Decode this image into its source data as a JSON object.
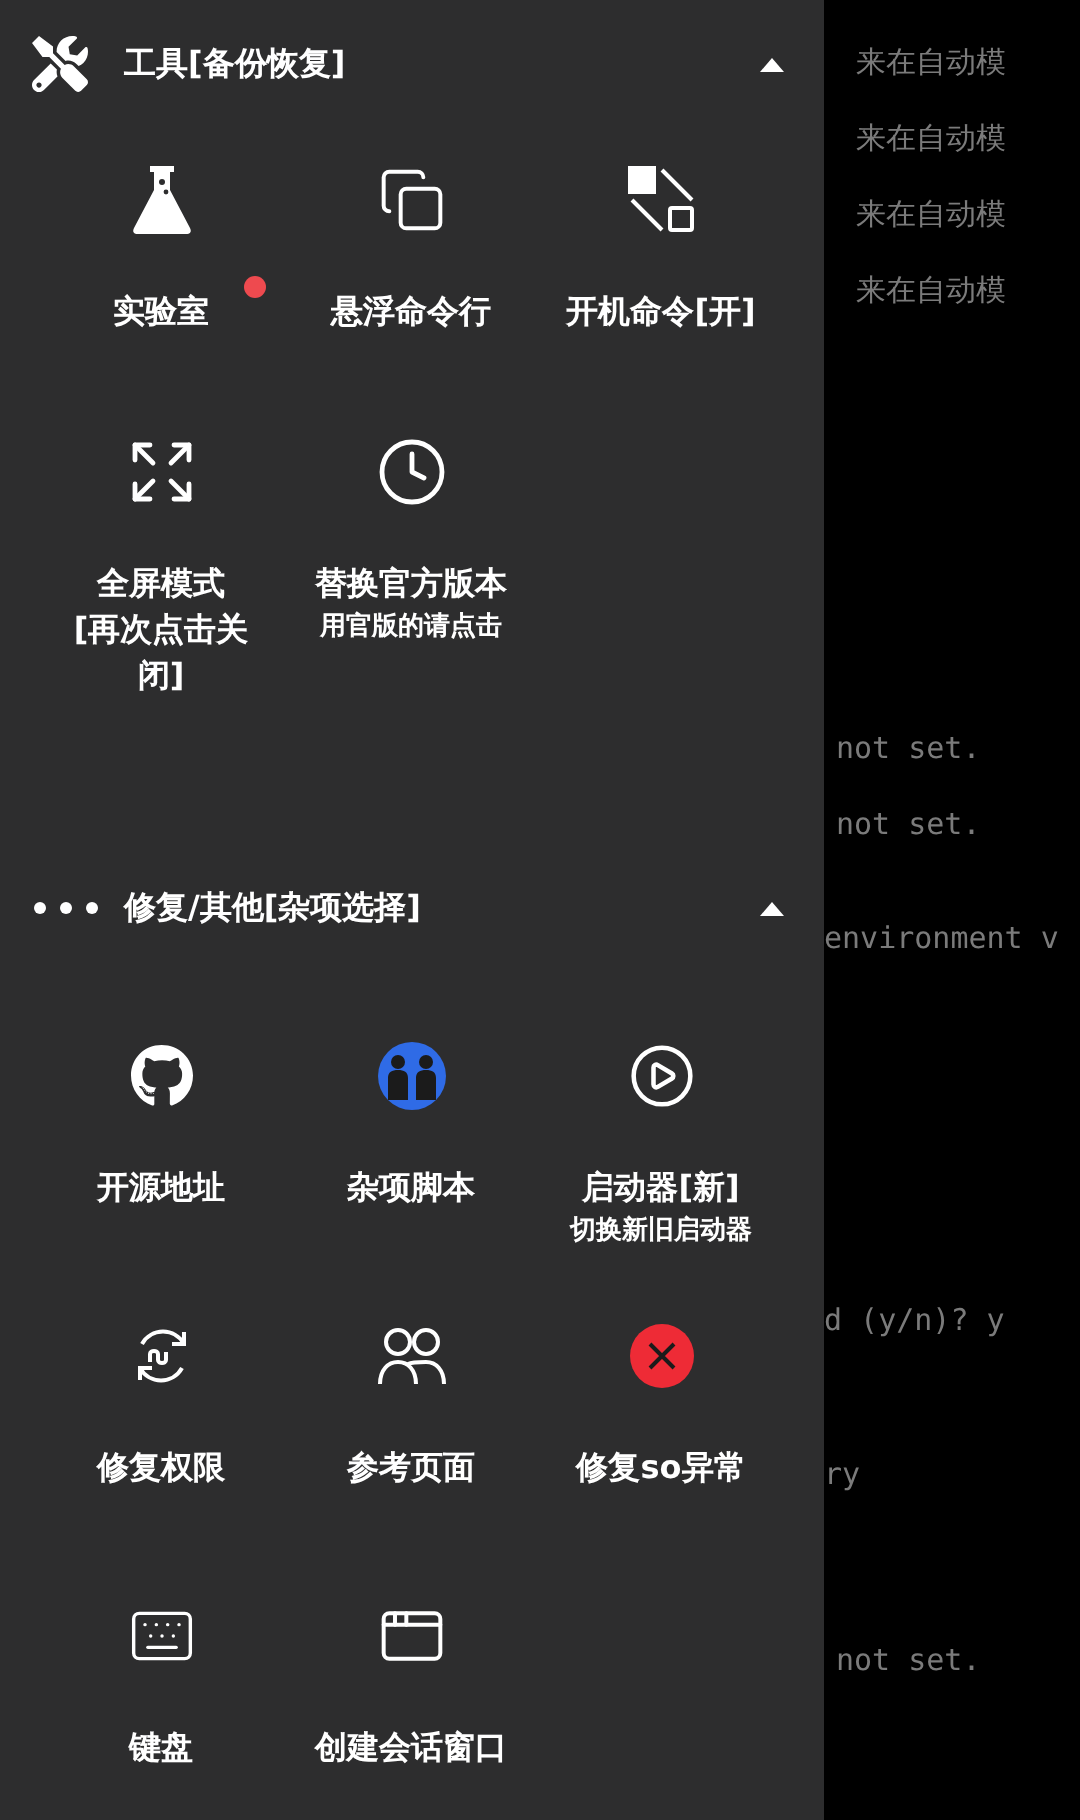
{
  "drawer": {
    "sections": [
      {
        "title": "工具[备份恢复]",
        "expanded": true,
        "items": [
          {
            "label": "实验室",
            "dot": true
          },
          {
            "label": "悬浮命令行",
            "dot": false
          },
          {
            "label": "开机命令[开]",
            "dot": false
          },
          {
            "label": "全屏模式\n[再次点击关闭]",
            "dot": false
          },
          {
            "label": "替换官方版本",
            "sublabel": "用官版的请点击",
            "dot": false
          }
        ]
      },
      {
        "title": "修复/其他[杂项选择]",
        "expanded": true,
        "items": [
          {
            "label": "开源地址",
            "dot": false
          },
          {
            "label": "杂项脚本",
            "dot": false
          },
          {
            "label": "启动器[新]",
            "sublabel": "切换新旧启动器",
            "dot": false
          },
          {
            "label": "修复权限",
            "dot": false
          },
          {
            "label": "参考页面",
            "dot": false
          },
          {
            "label": "修复so异常",
            "dot": false
          },
          {
            "label": "键盘",
            "dot": false
          },
          {
            "label": "创建会话窗口",
            "dot": false
          }
        ]
      }
    ]
  },
  "terminal": {
    "lines": [
      "来在自动模",
      "来在自动模",
      "来在自动模",
      "来在自动模",
      "not set.",
      "not set.",
      "environment v",
      "d (y/n)? y",
      "ry",
      "not set."
    ]
  }
}
